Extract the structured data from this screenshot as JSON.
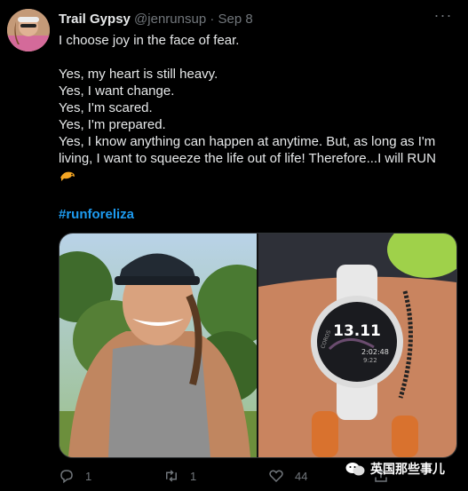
{
  "tweet": {
    "author_name": "Trail Gypsy",
    "author_handle": "@jenrunsup",
    "separator": "·",
    "timestamp": "Sep 8",
    "more_label": "···",
    "lines": [
      "I choose joy in the face of fear.",
      "",
      "Yes, my heart is still heavy.",
      "Yes, I want change.",
      "Yes, I'm scared.",
      "Yes, I'm prepared.",
      "Yes, I know anything can happen at anytime. But, as long as I'm",
      "living, I want to squeeze the life out of life! Therefore...I will RUN"
    ],
    "emoji": "dolphin-emoji",
    "hashtag": "#runforeliza",
    "media": {
      "left_photo": "selfie-photo",
      "right_photo": "watch-photo",
      "watch_distance": "13.11",
      "watch_brand": "COROS",
      "watch_time": "2:02:48",
      "watch_pace": "9:22"
    },
    "actions": {
      "reply_count": "1",
      "retweet_count": "1",
      "like_count": "44"
    }
  },
  "watermark": {
    "text": "英国那些事儿"
  },
  "colors": {
    "background": "#000000",
    "text": "#e7e9ea",
    "muted": "#71767b",
    "link": "#1d9bf0"
  }
}
